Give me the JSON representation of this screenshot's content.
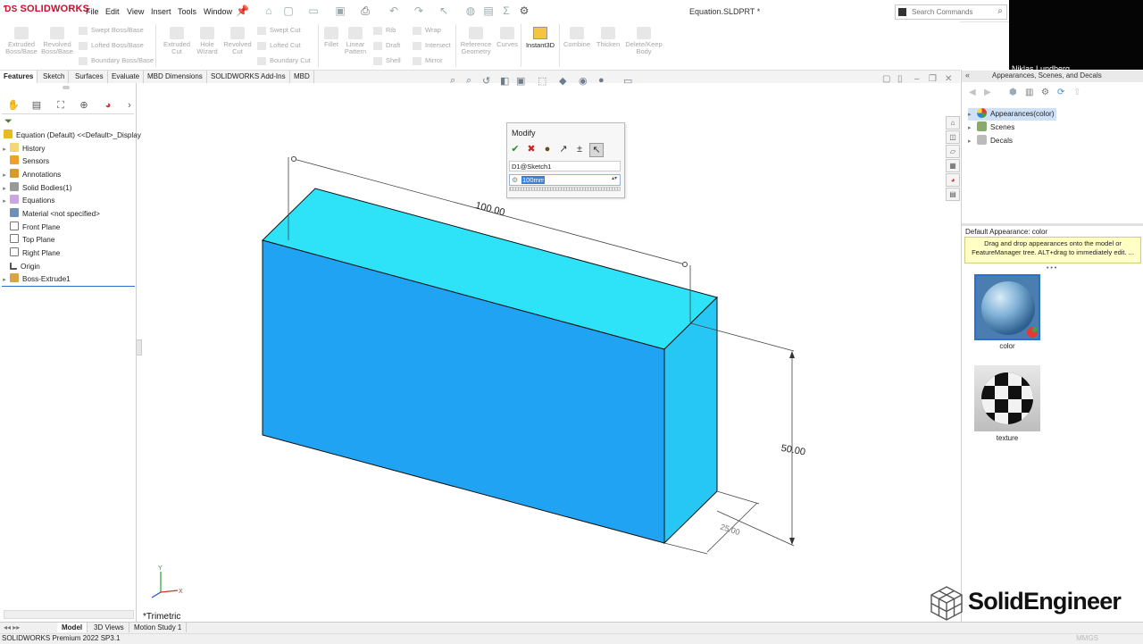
{
  "app": {
    "logo": "SOLIDWORKS",
    "document_title": "Equation.SLDPRT *",
    "menu": [
      "File",
      "Edit",
      "View",
      "Insert",
      "Tools",
      "Window"
    ],
    "search_placeholder": "Search Commands",
    "webcam_name": "Niklas Lundberg"
  },
  "ribbon": {
    "extruded_boss": "Extruded Boss/Base",
    "revolved_boss": "Revolved Boss/Base",
    "swept_boss": "Swept Boss/Base",
    "lofted_boss": "Lofted Boss/Base",
    "boundary_boss": "Boundary Boss/Base",
    "extruded_cut": "Extruded Cut",
    "hole_wizard": "Hole Wizard",
    "revolved_cut": "Revolved Cut",
    "swept_cut": "Swept Cut",
    "lofted_cut": "Lofted Cut",
    "boundary_cut": "Boundary Cut",
    "fillet": "Fillet",
    "linear_pattern": "Linear Pattern",
    "rib": "Rib",
    "draft": "Draft",
    "shell": "Shell",
    "wrap": "Wrap",
    "intersect": "Intersect",
    "mirror": "Mirror",
    "reference_geometry": "Reference Geometry",
    "curves": "Curves",
    "instant3d": "Instant3D",
    "combine": "Combine",
    "thicken": "Thicken",
    "delete_keep_body": "Delete/Keep Body"
  },
  "tabs": [
    "Features",
    "Sketch",
    "Surfaces",
    "Evaluate",
    "MBD Dimensions",
    "SOLIDWORKS Add-Ins",
    "MBD"
  ],
  "feature_tree": {
    "root": "Equation (Default) <<Default>_Display",
    "items": [
      "History",
      "Sensors",
      "Annotations",
      "Solid Bodies(1)",
      "Equations",
      "Material <not specified>",
      "Front Plane",
      "Top Plane",
      "Right Plane",
      "Origin",
      "Boss-Extrude1"
    ]
  },
  "modify_dialog": {
    "title": "Modify",
    "dimension_name": "D1@Sketch1",
    "value": "100mm"
  },
  "dimensions": {
    "length": "100.00",
    "height": "50.00",
    "depth": "25.00"
  },
  "view": {
    "orientation": "*Trimetric"
  },
  "bottom_tabs": [
    "Model",
    "3D Views",
    "Motion Study 1"
  ],
  "status": {
    "version": "SOLIDWORKS Premium 2022 SP3.1",
    "units": "MMGS"
  },
  "task_pane": {
    "title": "Appearances, Scenes, and Decals",
    "tree": [
      "Appearances(color)",
      "Scenes",
      "Decals"
    ],
    "default_appearance": "Default Appearance: color",
    "tip": "Drag and drop appearances onto the model or FeatureManager tree.  ALT+drag to immediately edit. ...",
    "swatches": [
      "color",
      "texture"
    ]
  },
  "brand": "SolidEngineer",
  "colors": {
    "part_front": "#1fa3f2",
    "part_top": "#2ee3f7",
    "part_side": "#27c7f5",
    "accent": "#c8102e"
  }
}
